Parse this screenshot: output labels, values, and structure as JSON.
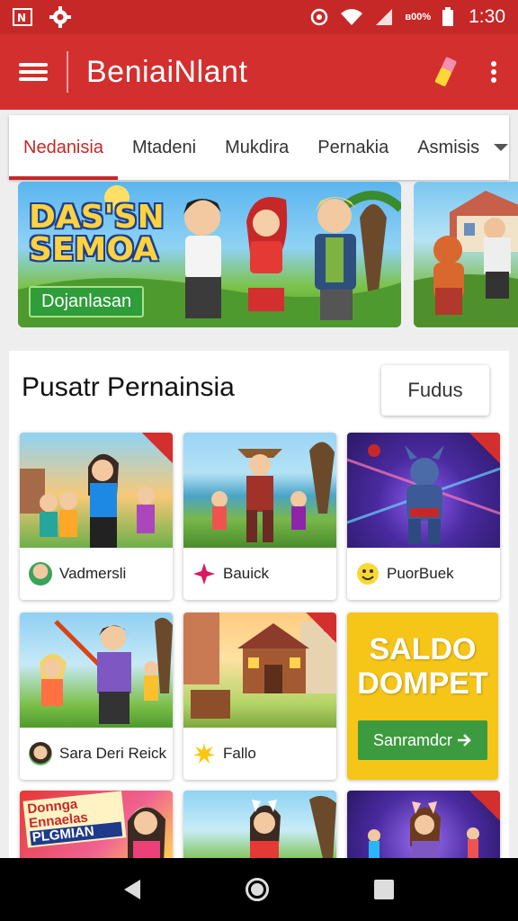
{
  "status_bar": {
    "time": "1:30",
    "small_text": "ʙ00%",
    "icons": [
      "notification-icon",
      "settings-icon",
      "sync-icon",
      "wifi-icon",
      "signal-icon",
      "battery-icon"
    ]
  },
  "app_bar": {
    "title": "BeniaiNlant"
  },
  "tabs": [
    {
      "label": "Nedanisia",
      "active": true
    },
    {
      "label": "Mtadeni"
    },
    {
      "label": "Mukdira"
    },
    {
      "label": "Pernakia"
    },
    {
      "label": "Asmisis"
    }
  ],
  "banner": {
    "logo_line1": "DAS'SN",
    "logo_line2": "SEMOA",
    "button_label": "Dojanlasan"
  },
  "section": {
    "title": "Pusatr Pernainsia",
    "filter_label": "Fudus"
  },
  "cards": [
    {
      "label": "Vadmersli"
    },
    {
      "label": "Bauick"
    },
    {
      "label": "PuorBuek"
    },
    {
      "label": "Sara Deri Reick"
    },
    {
      "label": "Fallo"
    }
  ],
  "wallet": {
    "title_line1": "SALDO",
    "title_line2": "DOMPET",
    "button_label": "Sanramdcr"
  },
  "bottom_banner": {
    "line1": "Donnga",
    "line2": "Ennaelas",
    "line3": "PLGMIAN"
  },
  "colors": {
    "primary": "#d32f2f",
    "status_bar": "#c62828",
    "wallet": "#f5c518",
    "green_button": "#3d9b3f"
  }
}
